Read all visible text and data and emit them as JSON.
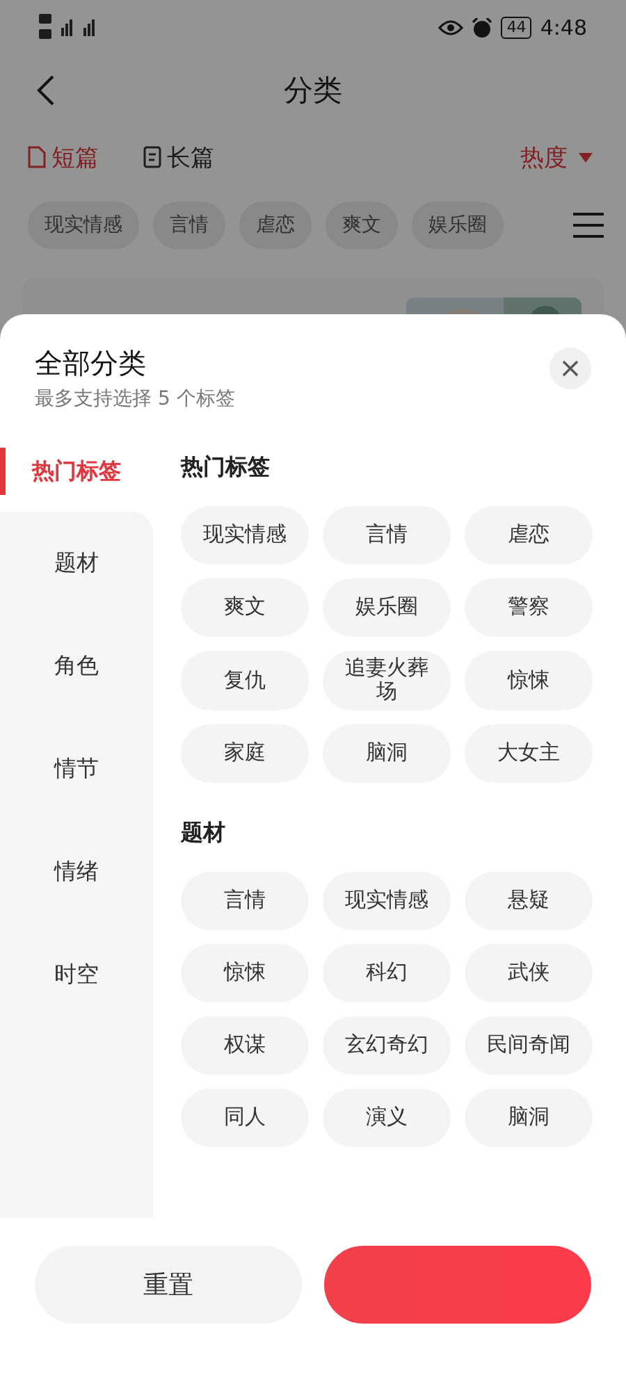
{
  "status_bar": {
    "time": "4:48",
    "battery": "44"
  },
  "header": {
    "title": "分类"
  },
  "length_tabs": [
    {
      "label": "短篇",
      "selected": true
    },
    {
      "label": "长篇",
      "selected": false
    }
  ],
  "sort": {
    "label": "热度"
  },
  "tag_bar": [
    "现实情感",
    "言情",
    "虐恋",
    "爽文",
    "娱乐圈"
  ],
  "sheet": {
    "title": "全部分类",
    "subtitle": "最多支持选择 5 个标签",
    "sidebar": [
      {
        "label": "热门标签",
        "selected": true
      },
      {
        "label": "题材",
        "selected": false
      },
      {
        "label": "角色",
        "selected": false
      },
      {
        "label": "情节",
        "selected": false
      },
      {
        "label": "情绪",
        "selected": false
      },
      {
        "label": "时空",
        "selected": false
      }
    ],
    "sections": [
      {
        "title": "热门标签",
        "tags": [
          "现实情感",
          "言情",
          "虐恋",
          "爽文",
          "娱乐圈",
          "警察",
          "复仇",
          "追妻火葬场",
          "惊悚",
          "家庭",
          "脑洞",
          "大女主"
        ]
      },
      {
        "title": "题材",
        "tags": [
          "言情",
          "现实情感",
          "悬疑",
          "惊悚",
          "科幻",
          "武侠",
          "权谋",
          "玄幻奇幻",
          "民间奇闻",
          "同人",
          "演义",
          "脑洞"
        ]
      }
    ],
    "buttons": [
      {
        "label": "重置",
        "kind": "secondary"
      },
      {
        "kind": "primary"
      }
    ]
  }
}
